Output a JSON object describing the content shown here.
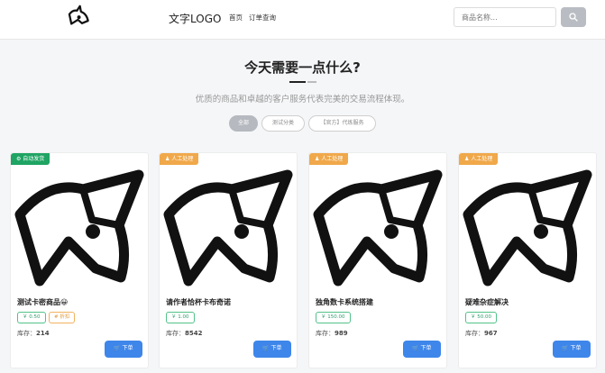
{
  "header": {
    "brand": "文字LOGO",
    "nav": [
      "首页",
      "订单查询"
    ],
    "search_placeholder": "商品名称...",
    "logo_icon": "unicorn-logo-icon",
    "search_icon": "search-icon"
  },
  "hero": {
    "title": "今天需要一点什么?",
    "subtitle": "优质的商品和卓越的客户服务代表完美的交易流程体现。"
  },
  "filters": [
    "全部",
    "测试分类",
    "【官方】代练服务"
  ],
  "colors": {
    "auto_badge": "#1fa463",
    "manual_badge": "#f0a84a",
    "buy_button": "#3e86ea",
    "price_border": "#52c28a"
  },
  "products": [
    {
      "badge": "⚙ 自动发货",
      "badge_type": "auto",
      "name": "测试卡密商品😀",
      "price": "￥ 0.50",
      "tag": "# 折扣",
      "stock_label": "库存：",
      "stock": "214",
      "buy": "🛒 下单"
    },
    {
      "badge": "♟ 人工处理",
      "badge_type": "manual",
      "name": "请作者恰杯卡布奇诺",
      "price": "￥ 1.00",
      "tag": "",
      "stock_label": "库存：",
      "stock": "8542",
      "buy": "🛒 下单"
    },
    {
      "badge": "♟ 人工处理",
      "badge_type": "manual",
      "name": "独角数卡系统搭建",
      "price": "￥ 150.00",
      "tag": "",
      "stock_label": "库存：",
      "stock": "989",
      "buy": "🛒 下单"
    },
    {
      "badge": "♟ 人工处理",
      "badge_type": "manual",
      "name": "疑难杂症解决",
      "price": "￥ 50.00",
      "tag": "",
      "stock_label": "库存：",
      "stock": "967",
      "buy": "🛒 下单"
    }
  ]
}
